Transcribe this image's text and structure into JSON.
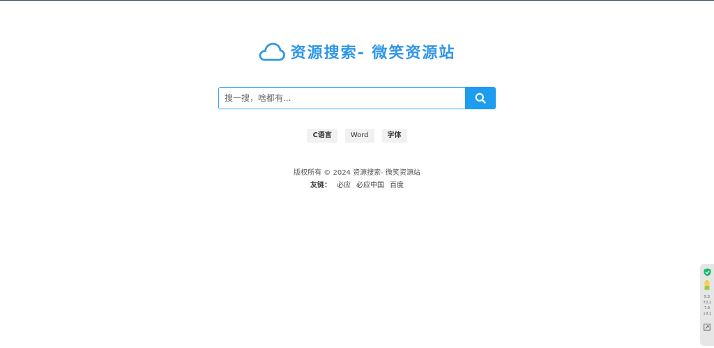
{
  "header": {
    "logo_icon": "cloud-icon",
    "title": "资源搜索- 微笑资源站",
    "accent_color": "#2f96e8"
  },
  "search": {
    "placeholder": "搜一搜，啥都有...",
    "value": "",
    "button_icon": "search-icon",
    "button_color": "#1e9cf0"
  },
  "tags": [
    {
      "label": "C语言"
    },
    {
      "label": "Word"
    },
    {
      "label": "字体"
    }
  ],
  "footer": {
    "copyright": "版权所有 © 2024 资源搜索- 微笑资源站",
    "links_label": "友链：",
    "links": [
      {
        "label": "必应"
      },
      {
        "label": "必应中国"
      },
      {
        "label": "百度"
      }
    ]
  },
  "side_widget": {
    "icons": [
      "shield-icon",
      "battery-icon",
      "expand-icon"
    ],
    "stats": [
      "5.3",
      "↑0.1",
      "7.9",
      "↓0.1"
    ]
  }
}
